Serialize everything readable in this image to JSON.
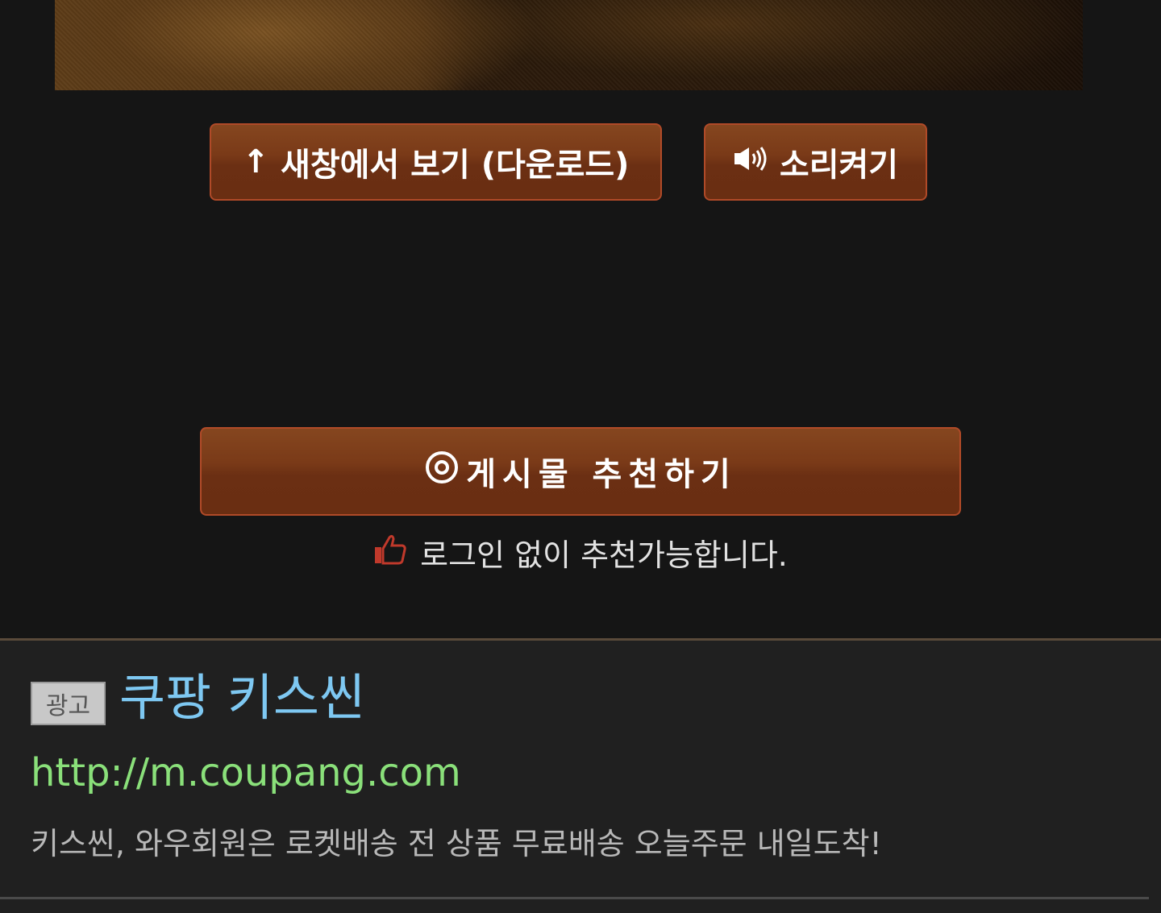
{
  "buttons": {
    "new_window": "새창에서 보기 (다운로드)",
    "sound_on": "소리켜기",
    "recommend": "게시물 추천하기"
  },
  "hint": {
    "text": "로그인 없이 추천가능합니다."
  },
  "ad": {
    "badge": "광고",
    "title": "쿠팡 키스씬",
    "url": "http://m.coupang.com",
    "description": "키스씬, 와우회원은 로켓배송 전 상품 무료배송 오늘주문 내일도착!"
  },
  "icons": {
    "new_window": "up-arrow-icon",
    "sound": "speaker-icon",
    "recommend": "target-icon",
    "hint": "thumbs-up-icon"
  },
  "colors": {
    "background": "#151515",
    "button_fill": "#6b2f13",
    "button_border": "#b04a28",
    "ad_title": "#7ec8f2",
    "ad_url": "#8ae07a"
  }
}
